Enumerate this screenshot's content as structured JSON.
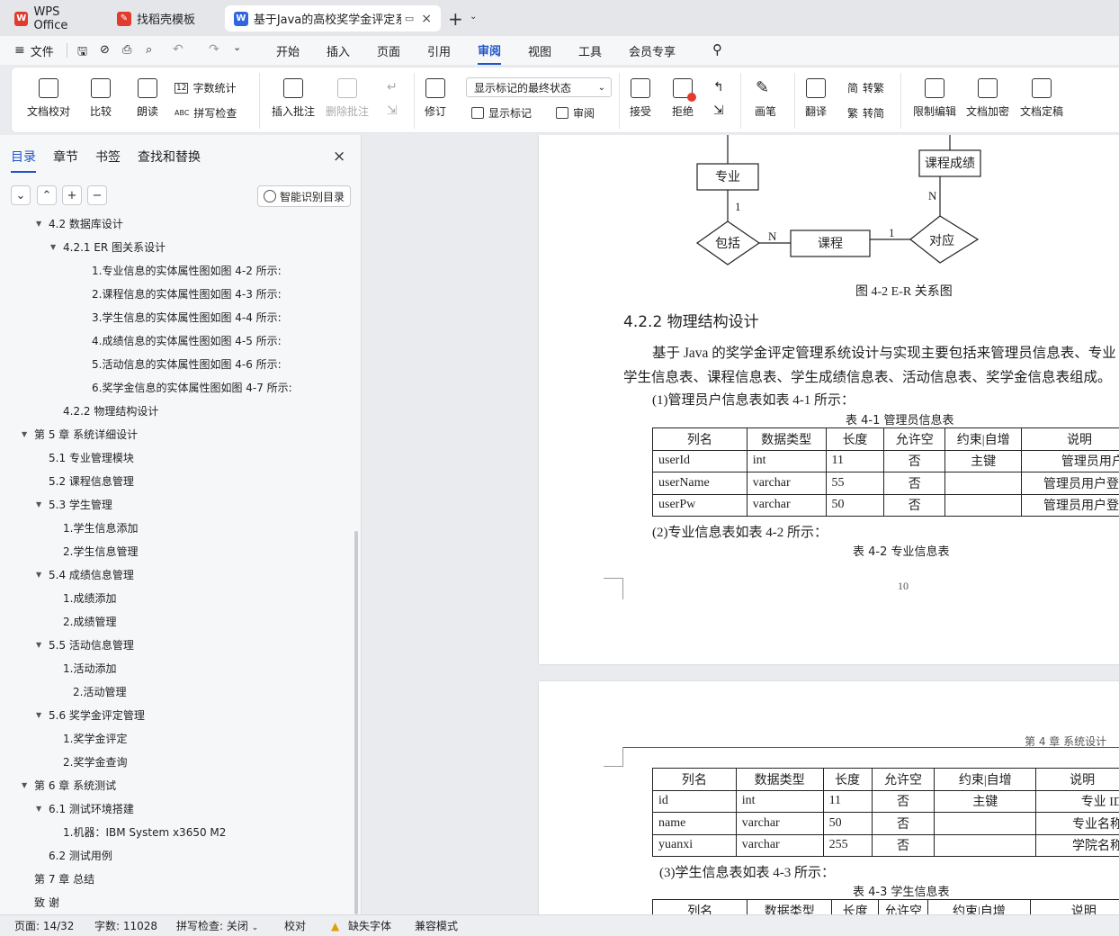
{
  "tabs": [
    {
      "label": "WPS Office"
    },
    {
      "label": "找稻壳模板"
    },
    {
      "label": "基于Java的高校奖学金评定系"
    }
  ],
  "menu": {
    "file": "文件",
    "items": [
      "开始",
      "插入",
      "页面",
      "引用",
      "审阅",
      "视图",
      "工具",
      "会员专享"
    ]
  },
  "ribbon": {
    "doc_check": "文档校对",
    "compare": "比较",
    "read_aloud": "朗读",
    "word_count": "字数统计",
    "spell_check": "拼写检查",
    "insert_comment": "插入批注",
    "delete_comment": "删除批注",
    "revise": "修订",
    "markup_state": "显示标记的最终状态",
    "show_markup": "显示标记",
    "review": "审阅",
    "accept": "接受",
    "reject": "拒绝",
    "pen": "画笔",
    "translate": "翻译",
    "to_trad": "转繁",
    "to_simp": "转简",
    "restrict_edit": "限制编辑",
    "encrypt": "文档加密",
    "finalize": "文档定稿",
    "word_count_icon": "12",
    "abc": "ABC",
    "trad_char": "繁",
    "simp_char": "简"
  },
  "sidebar": {
    "tabs": [
      "目录",
      "章节",
      "书签",
      "查找和替换"
    ],
    "smart_btn": "智能识别目录",
    "toc": [
      {
        "text": "4.2 数据库设计",
        "level": 1,
        "arrow": true
      },
      {
        "text": "4.2.1 ER 图关系设计",
        "level": 2,
        "arrow": true
      },
      {
        "text": "1.专业信息的实体属性图如图 4-2 所示:",
        "level": 3
      },
      {
        "text": "2.课程信息的实体属性图如图 4-3 所示:",
        "level": 3
      },
      {
        "text": "3.学生信息的实体属性图如图 4-4 所示:",
        "level": 3
      },
      {
        "text": "4.成绩信息的实体属性图如图 4-5 所示:",
        "level": 3
      },
      {
        "text": "5.活动信息的实体属性图如图 4-6 所示:",
        "level": 3
      },
      {
        "text": "6.奖学金信息的实体属性图如图 4-7 所示:",
        "level": 3
      },
      {
        "text": "4.2.2 物理结构设计",
        "level": 2
      },
      {
        "text": "第 5 章  系统详细设计",
        "level": 0,
        "arrow": true
      },
      {
        "text": "5.1  专业管理模块",
        "level": 1
      },
      {
        "text": "5.2  课程信息管理",
        "level": 1
      },
      {
        "text": "5.3  学生管理",
        "level": 1,
        "arrow": true
      },
      {
        "text": "1.学生信息添加",
        "level": 2
      },
      {
        "text": "2.学生信息管理",
        "level": 2
      },
      {
        "text": "5.4  成绩信息管理",
        "level": 1,
        "arrow": true
      },
      {
        "text": "1.成绩添加",
        "level": 2
      },
      {
        "text": "2.成绩管理",
        "level": 2
      },
      {
        "text": "5.5  活动信息管理",
        "level": 1,
        "arrow": true
      },
      {
        "text": "1.活动添加",
        "level": 2
      },
      {
        "text": "2.活动管理",
        "level": 2,
        "extra": true
      },
      {
        "text": "5.6  奖学金评定管理",
        "level": 1,
        "arrow": true
      },
      {
        "text": "1.奖学金评定",
        "level": 2
      },
      {
        "text": "2.奖学金查询",
        "level": 2
      },
      {
        "text": "第 6 章  系统测试",
        "level": 0,
        "arrow": true
      },
      {
        "text": "6.1 测试环境搭建",
        "level": 1,
        "arrow": true
      },
      {
        "text": "1.机器：IBM  System  x3650  M2",
        "level": 2
      },
      {
        "text": "6.2 测试用例",
        "level": 1
      },
      {
        "text": "第 7 章  总结",
        "level": 0
      },
      {
        "text": "致  谢",
        "level": 0
      }
    ]
  },
  "doc": {
    "er": {
      "major": "专业",
      "course_grade": "课程成绩",
      "include": "包括",
      "course": "课程",
      "correspond": "对应",
      "one_a": "1",
      "n_a": "N",
      "one_b": "1",
      "n_b": "N",
      "caption": "图 4-2 E-R 关系图"
    },
    "section_title": "4.2.2 物理结构设计",
    "para1": "基于 Java 的奖学金评定管理系统设计与实现主要包括来管理员信息表、专业",
    "para2": "学生信息表、课程信息表、学生成绩信息表、活动信息表、奖学金信息表组成。",
    "t1_intro": "(1)管理员户信息表如表 4-1 所示：",
    "t1_caption": "表 4-1  管理员信息表",
    "t1": {
      "header": [
        "列名",
        "数据类型",
        "长度",
        "允许空",
        "约束|自增",
        "说明"
      ],
      "rows": [
        [
          "userId",
          "int",
          "11",
          "否",
          "主键",
          "管理员用户 I"
        ],
        [
          "userName",
          "varchar",
          "55",
          "否",
          "",
          "管理员用户登录"
        ],
        [
          "userPw",
          "varchar",
          "50",
          "否",
          "",
          "管理员用户登录"
        ]
      ]
    },
    "t2_intro": "(2)专业信息表如表 4-2 所示：",
    "t2_caption": "表 4-2  专业信息表",
    "page_num": "10",
    "header_right": "第 4 章  系统设计",
    "t2": {
      "header": [
        "列名",
        "数据类型",
        "长度",
        "允许空",
        "约束|自增",
        "说明"
      ],
      "rows": [
        [
          "id",
          "int",
          "11",
          "否",
          "主键",
          "专业 ID"
        ],
        [
          "name",
          "varchar",
          "50",
          "否",
          "",
          "专业名称"
        ],
        [
          "yuanxi",
          "varchar",
          "255",
          "否",
          "",
          "学院名称"
        ]
      ]
    },
    "t3_intro": "(3)学生信息表如表 4-3 所示：",
    "t3_caption": "表 4-3  学生信息表",
    "t3": {
      "header": [
        "列名",
        "数据类型",
        "长度",
        "允许空",
        "约束|自增",
        "说明"
      ]
    }
  },
  "status": {
    "page": "页面: 14/32",
    "words": "字数: 11028",
    "spell": "拼写检查: 关闭",
    "proof": "校对",
    "missing_font": "缺失字体",
    "compat": "兼容模式"
  },
  "colors": {
    "accent": "#1f55c8",
    "wps_red": "#e23b2e"
  }
}
